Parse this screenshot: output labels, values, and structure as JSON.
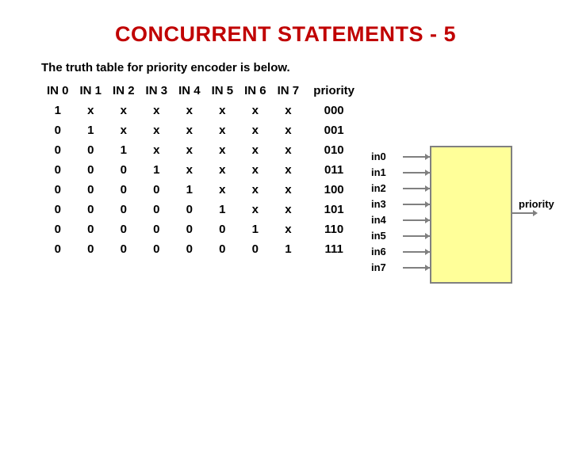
{
  "title": "CONCURRENT STATEMENTS - 5",
  "subtitle": "The truth table for priority encoder is below.",
  "headers": [
    "IN 0",
    "IN 1",
    "IN 2",
    "IN 3",
    "IN 4",
    "IN 5",
    "IN 6",
    "IN 7",
    "priority"
  ],
  "rows": [
    [
      "1",
      "x",
      "x",
      "x",
      "x",
      "x",
      "x",
      "x",
      "000"
    ],
    [
      "0",
      "1",
      "x",
      "x",
      "x",
      "x",
      "x",
      "x",
      "001"
    ],
    [
      "0",
      "0",
      "1",
      "x",
      "x",
      "x",
      "x",
      "x",
      "010"
    ],
    [
      "0",
      "0",
      "0",
      "1",
      "x",
      "x",
      "x",
      "x",
      "011"
    ],
    [
      "0",
      "0",
      "0",
      "0",
      "1",
      "x",
      "x",
      "x",
      "100"
    ],
    [
      "0",
      "0",
      "0",
      "0",
      "0",
      "1",
      "x",
      "x",
      "101"
    ],
    [
      "0",
      "0",
      "0",
      "0",
      "0",
      "0",
      "1",
      "x",
      "110"
    ],
    [
      "0",
      "0",
      "0",
      "0",
      "0",
      "0",
      "0",
      "1",
      "111"
    ]
  ],
  "inputs": [
    "in0",
    "in1",
    "in2",
    "in3",
    "in4",
    "in5",
    "in6",
    "in7"
  ],
  "output": "priority",
  "chart_data": {
    "type": "table",
    "title": "Priority encoder truth table",
    "columns": [
      "IN 0",
      "IN 1",
      "IN 2",
      "IN 3",
      "IN 4",
      "IN 5",
      "IN 6",
      "IN 7",
      "priority"
    ],
    "rows": [
      [
        "1",
        "x",
        "x",
        "x",
        "x",
        "x",
        "x",
        "x",
        "000"
      ],
      [
        "0",
        "1",
        "x",
        "x",
        "x",
        "x",
        "x",
        "x",
        "001"
      ],
      [
        "0",
        "0",
        "1",
        "x",
        "x",
        "x",
        "x",
        "x",
        "010"
      ],
      [
        "0",
        "0",
        "0",
        "1",
        "x",
        "x",
        "x",
        "x",
        "011"
      ],
      [
        "0",
        "0",
        "0",
        "0",
        "1",
        "x",
        "x",
        "x",
        "100"
      ],
      [
        "0",
        "0",
        "0",
        "0",
        "0",
        "1",
        "x",
        "x",
        "101"
      ],
      [
        "0",
        "0",
        "0",
        "0",
        "0",
        "0",
        "1",
        "x",
        "110"
      ],
      [
        "0",
        "0",
        "0",
        "0",
        "0",
        "0",
        "0",
        "1",
        "111"
      ]
    ]
  }
}
